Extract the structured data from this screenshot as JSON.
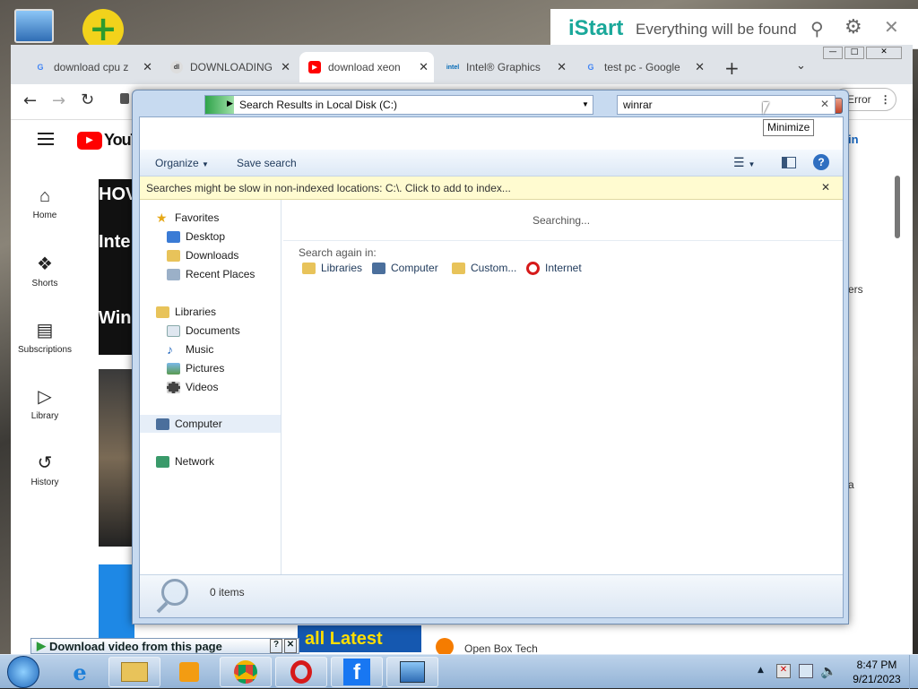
{
  "istart": {
    "logo": "iStart",
    "tagline": "Everything will be found"
  },
  "browser": {
    "tabs": [
      {
        "label": "download cpu z",
        "favicon": "G",
        "color": "#4285f4"
      },
      {
        "label": "DOWNLOADING",
        "favicon": "dl",
        "color": "#555"
      },
      {
        "label": "download xeon",
        "favicon": "▶",
        "color": "#ff0000"
      },
      {
        "label": "Intel® Graphics",
        "favicon": "intel",
        "color": "#0068b5"
      },
      {
        "label": "test pc - Google",
        "favicon": "G",
        "color": "#4285f4"
      }
    ],
    "error_label": "Error",
    "youtube": {
      "logo": "YouTube",
      "nav": [
        {
          "label": "Home",
          "icon": "home-icon"
        },
        {
          "label": "Shorts",
          "icon": "shorts-icon"
        },
        {
          "label": "Subscriptions",
          "icon": "subscriptions-icon"
        },
        {
          "label": "Library",
          "icon": "library-icon"
        },
        {
          "label": "History",
          "icon": "history-icon"
        }
      ],
      "sign_in": "in",
      "side_text_1": "ers",
      "side_text_2": "a",
      "channel": "Open Box Tech",
      "thumb_text": "all Latest",
      "thumb_title_fragments": [
        "HOV",
        "Inte",
        "Win"
      ]
    }
  },
  "explorer": {
    "address": "Search Results in Local Disk (C:)",
    "search_query": "winrar",
    "tooltip": "Minimize",
    "commands": {
      "organize": "Organize",
      "save_search": "Save search"
    },
    "info_bar": "Searches might be slow in non-indexed locations: C:\\. Click to add to index...",
    "nav": {
      "favorites": {
        "title": "Favorites",
        "items": [
          "Desktop",
          "Downloads",
          "Recent Places"
        ]
      },
      "libraries": {
        "title": "Libraries",
        "items": [
          "Documents",
          "Music",
          "Pictures",
          "Videos"
        ]
      },
      "computer": "Computer",
      "network": "Network"
    },
    "content": {
      "status": "Searching...",
      "search_again": "Search again in:",
      "locations": [
        "Libraries",
        "Computer",
        "Custom...",
        "Internet"
      ]
    },
    "status_bar": "0 items"
  },
  "download_bar": "Download video from this page",
  "taskbar": {
    "time": "8:47 PM",
    "date": "9/21/2023",
    "apps": [
      "internet-explorer-icon",
      "file-explorer-icon",
      "media-player-icon",
      "chrome-icon",
      "opera-icon",
      "facebook-icon",
      "control-panel-icon"
    ]
  }
}
